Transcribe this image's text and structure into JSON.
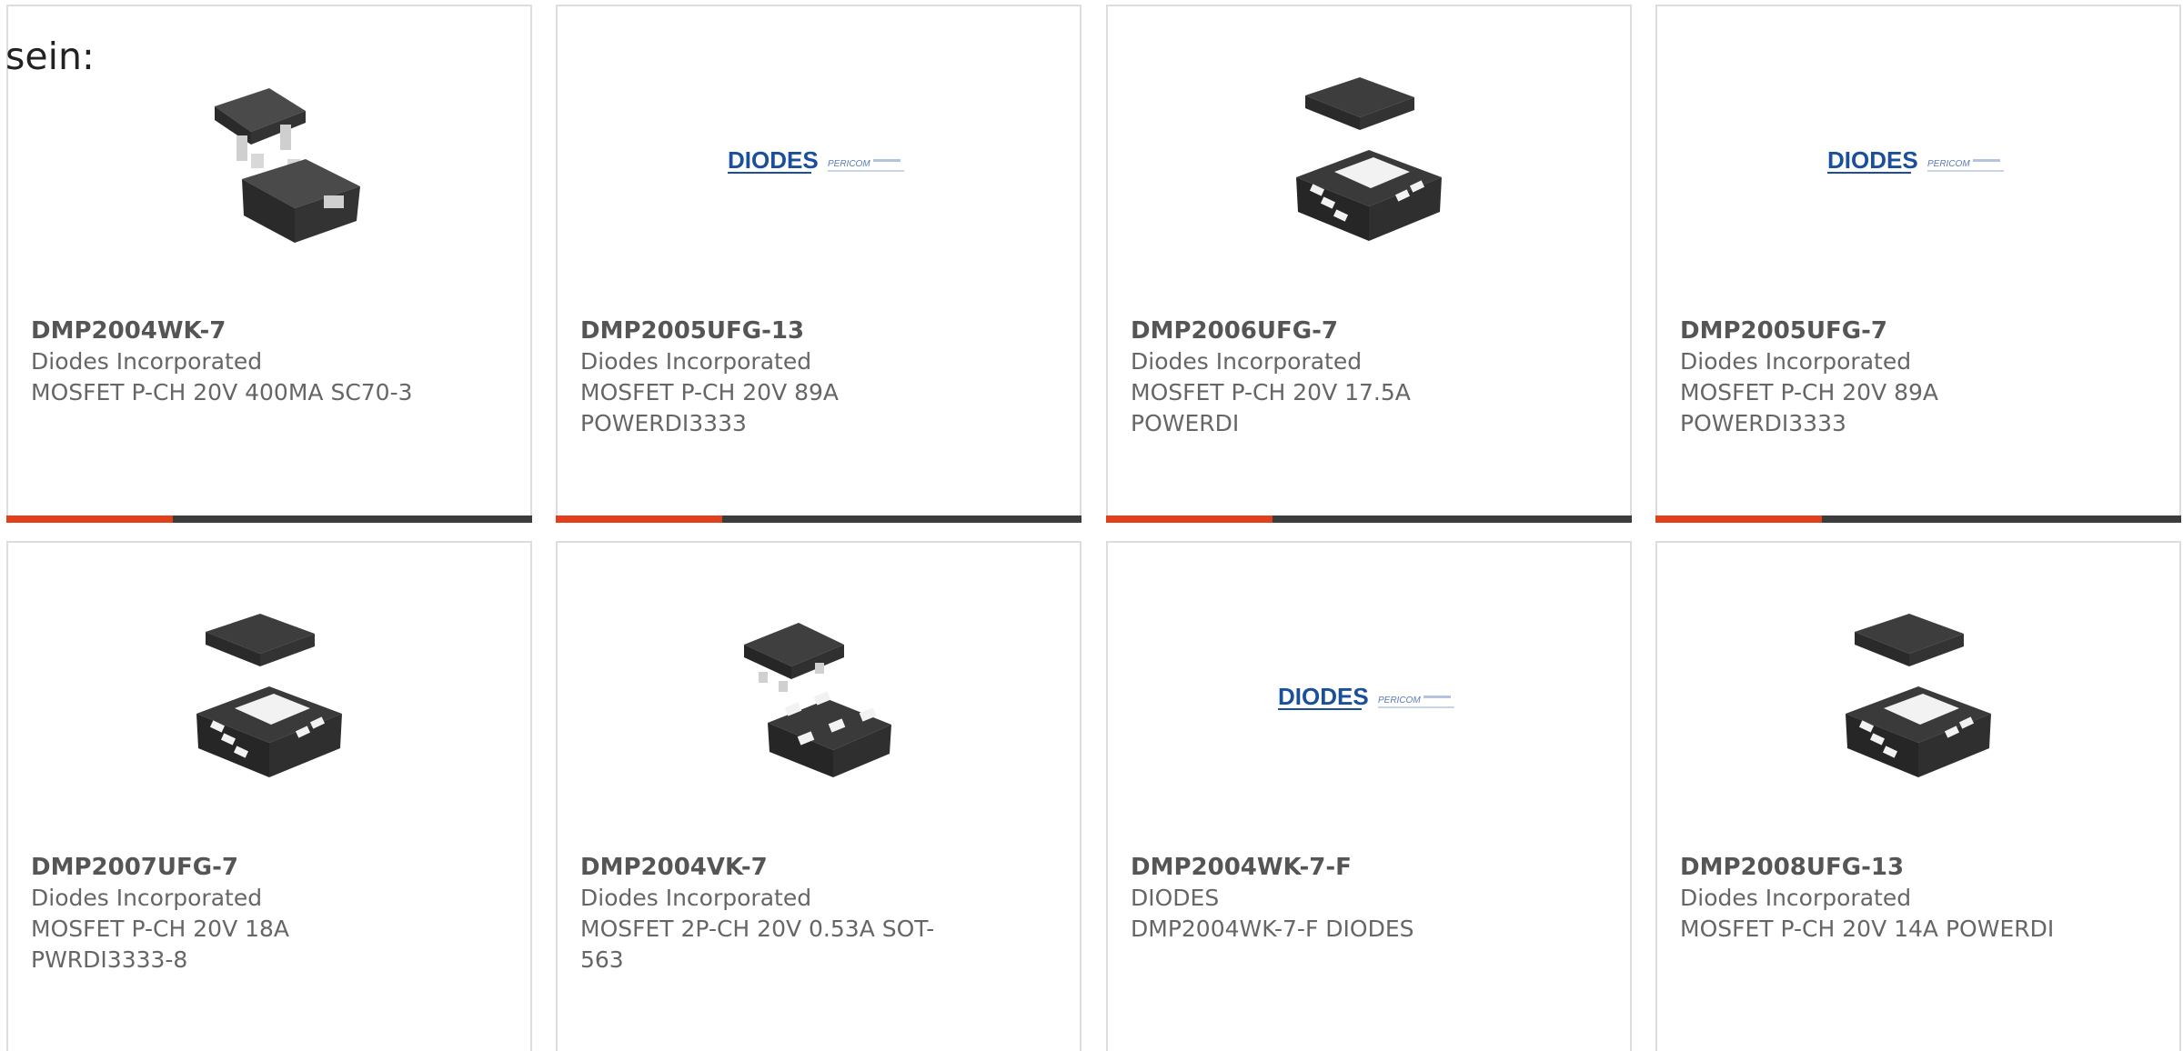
{
  "intro_text": "sein:",
  "colors": {
    "accent": "#e0401c",
    "bar": "#3c3c3c",
    "diodes_blue": "#1a4f9c",
    "chip": "#333333"
  },
  "products": [
    {
      "part": "DMP2004WK-7",
      "manufacturer": "Diodes Incorporated",
      "description": "MOSFET P-CH 20V 400MA SC70-3",
      "image": "sc70-package-icon"
    },
    {
      "part": "DMP2005UFG-13",
      "manufacturer": "Diodes Incorporated",
      "description": "MOSFET P-CH 20V 89A POWERDI3333",
      "image": "diodes-logo",
      "logo_text": "DIODES",
      "logo_sub": "PERICOM"
    },
    {
      "part": "DMP2006UFG-7",
      "manufacturer": "Diodes Incorporated",
      "description": "MOSFET P-CH 20V 17.5A POWERDI",
      "image": "powerdi-package-icon"
    },
    {
      "part": "DMP2005UFG-7",
      "manufacturer": "Diodes Incorporated",
      "description": "MOSFET P-CH 20V 89A POWERDI3333",
      "image": "diodes-logo",
      "logo_text": "DIODES",
      "logo_sub": "PERICOM"
    },
    {
      "part": "DMP2007UFG-7",
      "manufacturer": "Diodes Incorporated",
      "description": "MOSFET P-CH 20V 18A PWRDI3333-8",
      "image": "powerdi-package-icon"
    },
    {
      "part": "DMP2004VK-7",
      "manufacturer": "Diodes Incorporated",
      "description": "MOSFET 2P-CH 20V 0.53A SOT-563",
      "image": "sot563-package-icon"
    },
    {
      "part": "DMP2004WK-7-F",
      "manufacturer": "DIODES",
      "description": "DMP2004WK-7-F DIODES",
      "image": "diodes-logo",
      "logo_text": "DIODES",
      "logo_sub": "PERICOM"
    },
    {
      "part": "DMP2008UFG-13",
      "manufacturer": "Diodes Incorporated",
      "description": "MOSFET P-CH 20V 14A POWERDI",
      "image": "powerdi-package-icon"
    }
  ]
}
